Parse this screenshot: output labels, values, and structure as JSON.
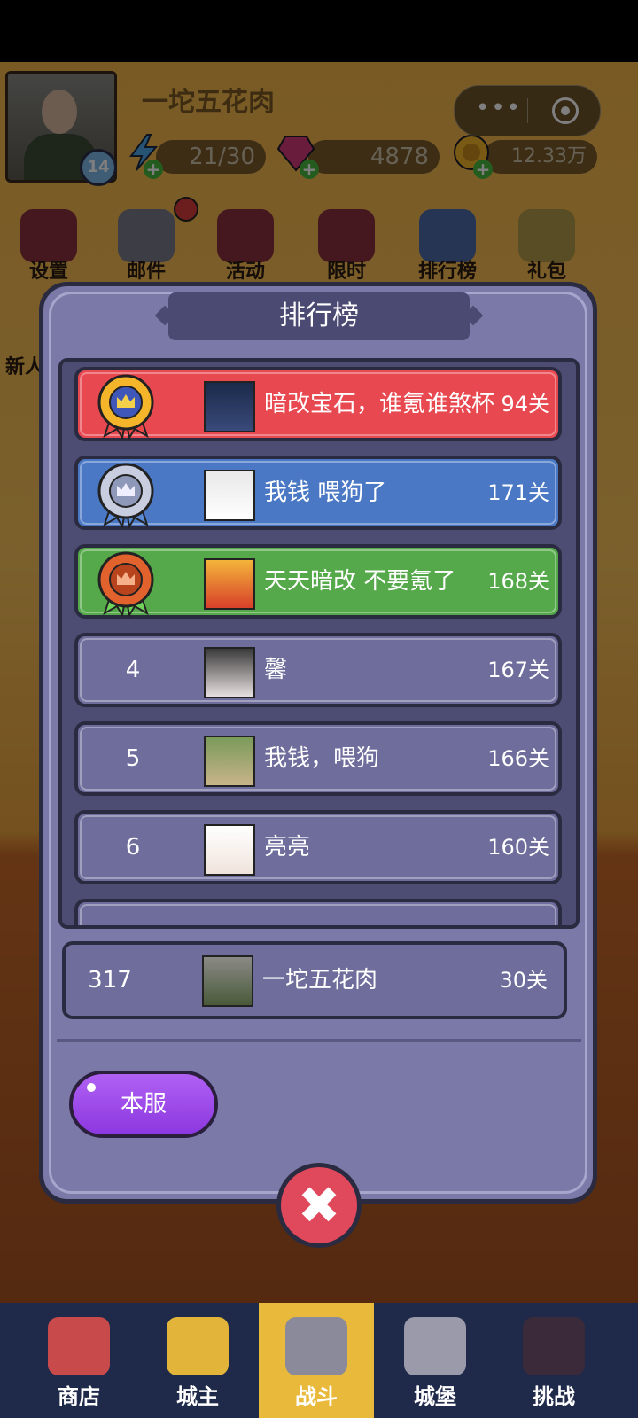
{
  "player": {
    "name": "一坨五花肉",
    "level": "14"
  },
  "resources": {
    "energy": "21/30",
    "gems": "4878",
    "coins": "12.33万"
  },
  "capsule": {
    "more": "•••"
  },
  "top_menu": [
    {
      "label": "设置",
      "icon": "gear-icon"
    },
    {
      "label": "邮件",
      "icon": "mail-icon"
    },
    {
      "label": "活动",
      "icon": "gift-box-icon"
    },
    {
      "label": "限时",
      "icon": "clock-gift-icon"
    },
    {
      "label": "排行榜",
      "icon": "bar-chart-icon"
    },
    {
      "label": "礼包",
      "icon": "present-icon"
    }
  ],
  "side_label": "新人",
  "leaderboard": {
    "title": "排行榜",
    "rows": [
      {
        "rank": "1",
        "name": "暗改宝石，谁氪谁煞杯",
        "score": "94关",
        "color": "#e8484f"
      },
      {
        "rank": "2",
        "name": "我钱 喂狗了",
        "score": "171关",
        "color": "#4a78c4"
      },
      {
        "rank": "3",
        "name": "天天暗改 不要氪了",
        "score": "168关",
        "color": "#55a94a"
      },
      {
        "rank": "4",
        "name": "馨",
        "score": "167关",
        "color": "#6e6d9c"
      },
      {
        "rank": "5",
        "name": "我钱，喂狗",
        "score": "166关",
        "color": "#6e6d9c"
      },
      {
        "rank": "6",
        "name": "亮亮",
        "score": "160关",
        "color": "#6e6d9c"
      }
    ],
    "self": {
      "rank": "317",
      "name": "一坨五花肉",
      "score": "30关"
    },
    "server_button": "本服",
    "close": "✖"
  },
  "bottom_nav": [
    {
      "label": "商店",
      "icon": "shop-icon"
    },
    {
      "label": "城主",
      "icon": "crown-icon"
    },
    {
      "label": "战斗",
      "icon": "crossed-swords-icon"
    },
    {
      "label": "城堡",
      "icon": "castle-icon"
    },
    {
      "label": "挑战",
      "icon": "demon-icon"
    }
  ]
}
